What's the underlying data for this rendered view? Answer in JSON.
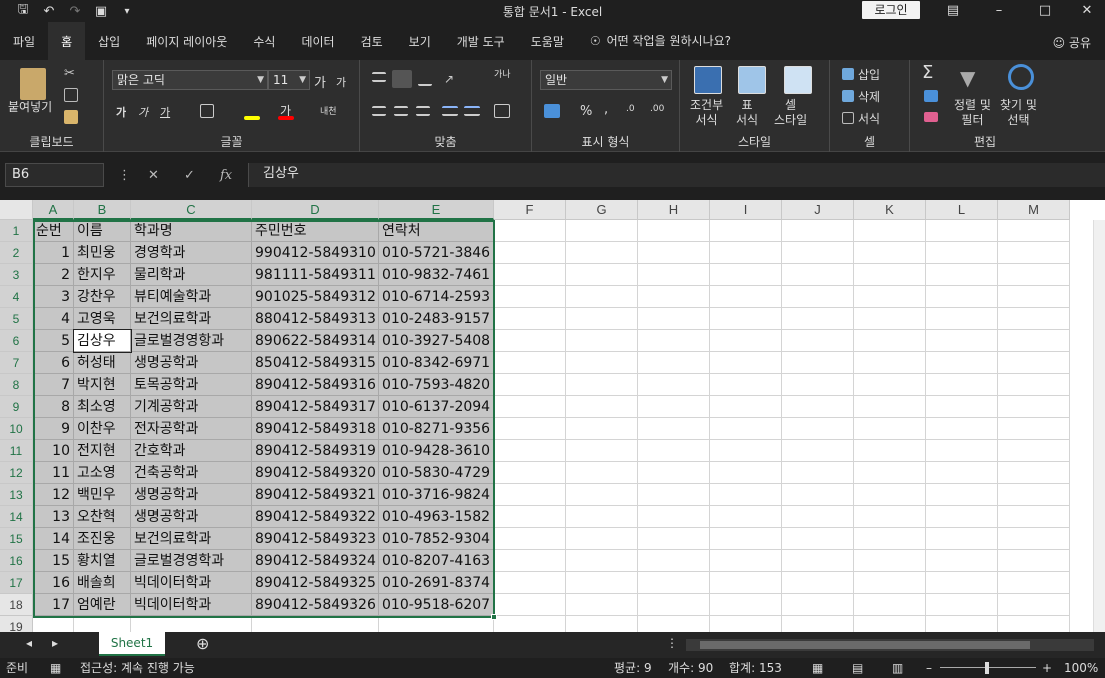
{
  "window": {
    "title": "통합 문서1  -  Excel",
    "login": "로그인"
  },
  "menu": {
    "tabs": [
      "파일",
      "홈",
      "삽입",
      "페이지 레이아웃",
      "수식",
      "데이터",
      "검토",
      "보기",
      "개발 도구",
      "도움말"
    ],
    "active_tab": "홈",
    "tell_me": "어떤 작업을 원하시나요?",
    "share": "공유"
  },
  "ribbon": {
    "clipboard": {
      "paste": "붙여넣기",
      "label": "클립보드"
    },
    "font": {
      "name": "맑은 고딕",
      "size": "11",
      "label": "글꼴",
      "grow": "가",
      "shrink": "가",
      "bold": "가",
      "italic": "가",
      "underline": "가",
      "color": "가",
      "phonetic": "내천"
    },
    "alignment": {
      "label": "맞춤",
      "wrap": "가나"
    },
    "number": {
      "format": "일반",
      "label": "표시 형식"
    },
    "styles": {
      "conditional": "조건부\n서식",
      "table": "표\n서식",
      "cell": "셀\n스타일",
      "label": "스타일"
    },
    "cells": {
      "insert": "삽입",
      "delete": "삭제",
      "format": "서식",
      "label": "셀"
    },
    "editing": {
      "sort": "정렬 및\n필터",
      "find": "찾기 및\n선택",
      "label": "편집"
    }
  },
  "formula_bar": {
    "name_box": "B6",
    "formula": "김상우"
  },
  "columns": [
    "A",
    "B",
    "C",
    "D",
    "E",
    "F",
    "G",
    "H",
    "I",
    "J",
    "K",
    "L",
    "M"
  ],
  "rows": [
    "1",
    "2",
    "3",
    "4",
    "5",
    "6",
    "7",
    "8",
    "9",
    "10",
    "11",
    "12",
    "13",
    "14",
    "15",
    "16",
    "17",
    "18",
    "19"
  ],
  "header_row": [
    "순번",
    "이름",
    "학과명",
    "주민번호",
    "연락처"
  ],
  "data_rows": [
    [
      "1",
      "최민웅",
      "경영학과",
      "990412-5849310",
      "010-5721-3846"
    ],
    [
      "2",
      "한지우",
      "물리학과",
      "981111-5849311",
      "010-9832-7461"
    ],
    [
      "3",
      "강찬우",
      "뷰티예술학과",
      "901025-5849312",
      "010-6714-2593"
    ],
    [
      "4",
      "고영욱",
      "보건의료학과",
      "880412-5849313",
      "010-2483-9157"
    ],
    [
      "5",
      "김상우",
      "글로벌경영항과",
      "890622-5849314",
      "010-3927-5408"
    ],
    [
      "6",
      "허성태",
      "생명공학과",
      "850412-5849315",
      "010-8342-6971"
    ],
    [
      "7",
      "박지현",
      "토목공학과",
      "890412-5849316",
      "010-7593-4820"
    ],
    [
      "8",
      "최소영",
      "기계공학과",
      "890412-5849317",
      "010-6137-2094"
    ],
    [
      "9",
      "이찬우",
      "전자공학과",
      "890412-5849318",
      "010-8271-9356"
    ],
    [
      "10",
      "전지현",
      "간호학과",
      "890412-5849319",
      "010-9428-3610"
    ],
    [
      "11",
      "고소영",
      "건축공학과",
      "890412-5849320",
      "010-5830-4729"
    ],
    [
      "12",
      "백민우",
      "생명공학과",
      "890412-5849321",
      "010-3716-9824"
    ],
    [
      "13",
      "오찬혁",
      "생명공학과",
      "890412-5849322",
      "010-4963-1582"
    ],
    [
      "14",
      "조진웅",
      "보건의료학과",
      "890412-5849323",
      "010-7852-9304"
    ],
    [
      "15",
      "황치열",
      "글로벌경영학과",
      "890412-5849324",
      "010-8207-4163"
    ],
    [
      "16",
      "배솔희",
      "빅데이터학과",
      "890412-5849325",
      "010-2691-8374"
    ],
    [
      "17",
      "엄예란",
      "빅데이터학과",
      "890412-5849326",
      "010-9518-6207"
    ]
  ],
  "sheet_tab": "Sheet1",
  "status": {
    "ready": "준비",
    "accessibility": "접근성: 계속 진행 가능",
    "average": "평균: 9",
    "count": "개수: 90",
    "sum": "합계: 153",
    "zoom": "100%"
  },
  "colors": {
    "accent": "#217346",
    "selection": "#c6c6c6"
  }
}
